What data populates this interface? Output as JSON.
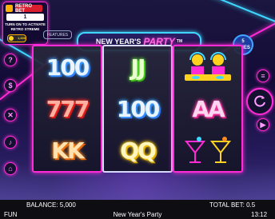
{
  "retro_bet": {
    "logo_label": "RETRO BET",
    "count": "1",
    "message": "TURN ON TO ACTIVATE RETRO XTREME",
    "toggle_label": "1,000"
  },
  "features_label": "FEATURES",
  "game_title": {
    "main": "NEW YEAR'S",
    "highlight": "PARTY",
    "tm": "TM"
  },
  "lines_badge": {
    "value": "5",
    "label": "LINES"
  },
  "reels": [
    {
      "symbols": [
        "100",
        "777",
        "KK"
      ],
      "colors": [
        "blue",
        "red",
        "orange"
      ]
    },
    {
      "symbols": [
        "JJ",
        "100",
        "QQ"
      ],
      "colors": [
        "green",
        "blue",
        "yellow"
      ]
    },
    {
      "symbols": [
        "DJ",
        "AA",
        "Cocktails"
      ],
      "colors": [
        "dj",
        "pink",
        "cocktail"
      ]
    }
  ],
  "icons": [
    "help-icon",
    "bet-icon",
    "tools-icon",
    "sound-icon",
    "home-icon",
    "spin-icon",
    "menu-icon",
    "autoplay-icon"
  ],
  "statusbar": {
    "balance": "BALANCE: 5,000",
    "total_bet": "TOTAL BET: 0.5",
    "mode": "FUN",
    "game_name": "New Year's Party",
    "clock": "13:12"
  }
}
